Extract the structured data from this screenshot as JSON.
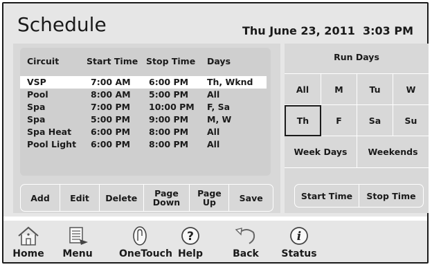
{
  "header": {
    "title": "Schedule",
    "datetime": "Thu June 23, 2011  3:03 PM"
  },
  "table": {
    "columns": [
      "Circuit",
      "Start Time",
      "Stop Time",
      "Days"
    ],
    "rows": [
      {
        "circuit": "VSP",
        "start": "7:00 AM",
        "stop": "6:00 PM",
        "days": "Th, Wknd",
        "selected": true
      },
      {
        "circuit": "Pool",
        "start": "8:00 AM",
        "stop": "5:00 PM",
        "days": "All"
      },
      {
        "circuit": "Spa",
        "start": "7:00 PM",
        "stop": "10:00 PM",
        "days": "F, Sa"
      },
      {
        "circuit": "Spa",
        "start": "5:00 PM",
        "stop": "9:00 PM",
        "days": "M, W"
      },
      {
        "circuit": "Spa Heat",
        "start": "6:00 PM",
        "stop": "8:00 PM",
        "days": "All"
      },
      {
        "circuit": "Pool Light",
        "start": "6:00 PM",
        "stop": "8:00 PM",
        "days": "All"
      }
    ]
  },
  "actions": {
    "add": "Add",
    "edit": "Edit",
    "delete": "Delete",
    "page_down": "Page\nDown",
    "page_up": "Page\nUp",
    "save": "Save"
  },
  "run_days": {
    "title": "Run Days",
    "all": "All",
    "mon": "M",
    "tue": "Tu",
    "wed": "W",
    "thu": "Th",
    "fri": "F",
    "sat": "Sa",
    "sun": "Su",
    "week_days": "Week Days",
    "weekends": "Weekends",
    "selected": "Th"
  },
  "time_buttons": {
    "start": "Start Time",
    "stop": "Stop Time"
  },
  "footer": {
    "home": "Home",
    "menu": "Menu",
    "onetouch": "OneTouch",
    "help": "Help",
    "back": "Back",
    "status": "Status"
  }
}
